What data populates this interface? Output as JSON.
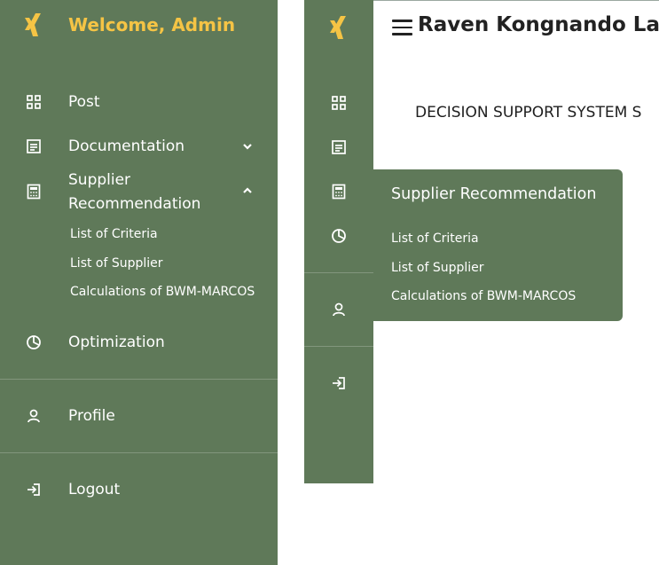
{
  "brand": {
    "welcome": "Welcome, Admin",
    "logo_icon": "xing-logo-icon",
    "accent_color": "#f5c445"
  },
  "theme": {
    "sidebar_bg": "#5f7959",
    "text": "#ffffff"
  },
  "sidebar": {
    "items": [
      {
        "label": "Post",
        "icon": "grid-icon"
      },
      {
        "label": "Documentation",
        "icon": "document-icon",
        "chevron": "chevron-down"
      },
      {
        "label": "Supplier Recommendation",
        "label_line1": "Supplier",
        "label_line2": "Recommendation",
        "icon": "calculator-icon",
        "chevron": "chevron-up",
        "subitems": [
          "List of Criteria",
          "List of Supplier",
          "Calculations of BWM-MARCOS"
        ]
      },
      {
        "label": "Optimization",
        "icon": "pie-chart-icon"
      },
      {
        "label": "Profile",
        "icon": "user-icon"
      },
      {
        "label": "Logout",
        "icon": "logout-icon"
      }
    ]
  },
  "header": {
    "owner_name": "Raven Kongnando Las"
  },
  "main": {
    "system_title": "DECISION SUPPORT SYSTEM S"
  },
  "flyout": {
    "title": "Supplier Recommendation",
    "items": [
      "List of Criteria",
      "List of Supplier",
      "Calculations of BWM-MARCOS"
    ]
  }
}
